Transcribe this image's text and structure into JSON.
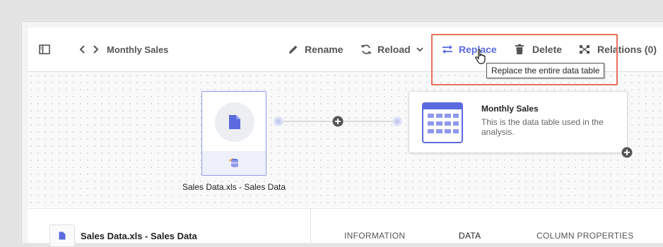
{
  "toolbar": {
    "title": "Monthly Sales",
    "rename_label": "Rename",
    "reload_label": "Reload",
    "replace_label": "Replace",
    "delete_label": "Delete",
    "relations_label": "Relations (0)"
  },
  "tooltip": "Replace the entire data table",
  "source": {
    "label": "Sales Data.xls - Sales Data"
  },
  "target": {
    "title": "Monthly Sales",
    "description": "This is the data table used in the analysis."
  },
  "bottom": {
    "file_name": "Sales Data.xls - Sales Data",
    "tabs": [
      "INFORMATION",
      "DATA",
      "COLUMN PROPERTIES"
    ]
  },
  "colors": {
    "accent": "#5b6bdf",
    "highlight": "#e8705c",
    "icon_gray": "#555555"
  },
  "icons": [
    "sidebar-toggle-icon",
    "back-icon",
    "forward-icon",
    "pencil-icon",
    "reload-icon",
    "chevron-down-icon",
    "replace-icon",
    "trash-icon",
    "relations-icon",
    "file-icon",
    "database-icon",
    "table-icon",
    "plus-icon",
    "pointer-cursor-icon"
  ]
}
